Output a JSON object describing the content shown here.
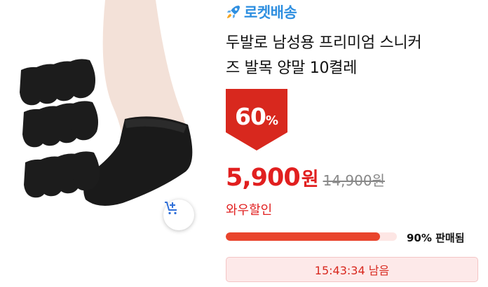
{
  "badge": {
    "label": "로켓배송",
    "icon": "rocket-icon",
    "color": "#2f8fe0"
  },
  "product": {
    "title_line1": "두발로 남성용 프리미엄 스니커",
    "title_line2": "즈 발목 양말 10켤레"
  },
  "discount": {
    "value": "60",
    "unit": "%"
  },
  "price": {
    "sale": "5,900",
    "unit": "원",
    "original": "14,900원"
  },
  "wow_label": "와우할인",
  "sales": {
    "percent_sold": 90,
    "label": "90% 판매됨"
  },
  "timer": {
    "text": "15:43:34 남음"
  },
  "colors": {
    "accent_red": "#e11f1f",
    "progress": "#e9442c",
    "timer_bg": "#fde9e9"
  }
}
